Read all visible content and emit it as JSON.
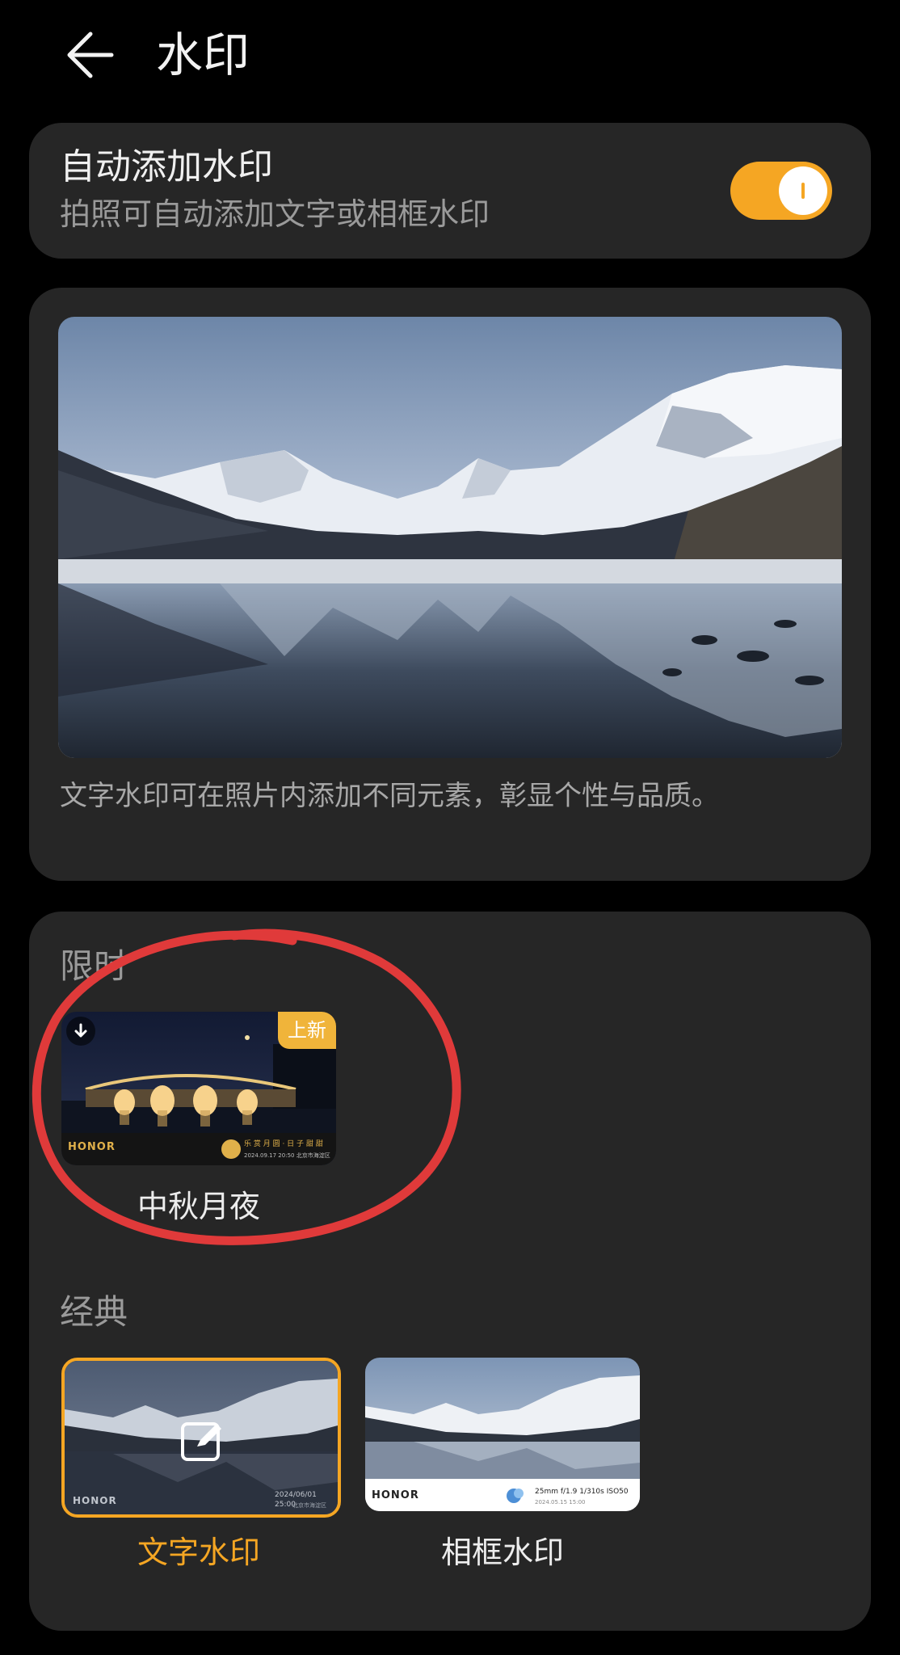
{
  "header": {
    "title": "水印"
  },
  "auto_watermark": {
    "title": "自动添加水印",
    "subtitle": "拍照可自动添加文字或相框水印",
    "enabled": true
  },
  "preview": {
    "description": "文字水印可在照片内添加不同元素，彰显个性与品质。"
  },
  "sections": {
    "limited": {
      "label": "限时",
      "items": [
        {
          "caption": "中秋月夜",
          "badge": "上新",
          "brand": "HONOR",
          "stamp_line1": "乐 赏 月 圆 · 日 子 甜 甜",
          "stamp_line2": "2024.09.17 20:50 北京市海淀区"
        }
      ]
    },
    "classic": {
      "label": "经典",
      "items": [
        {
          "caption": "文字水印",
          "selected": true,
          "brand": "HONOR",
          "stamp_line1": "2024/06/01 25:00",
          "stamp_line2": "北京市海淀区"
        },
        {
          "caption": "相框水印",
          "selected": false,
          "brand": "HONOR",
          "exif_line1": "25mm  f/1.9  1/310s  ISO50",
          "exif_line2": "2024.05.15 15:00"
        }
      ]
    }
  },
  "colors": {
    "accent": "#f5a623",
    "annotation": "#e03a3a",
    "card": "#262626",
    "background": "#000000"
  }
}
